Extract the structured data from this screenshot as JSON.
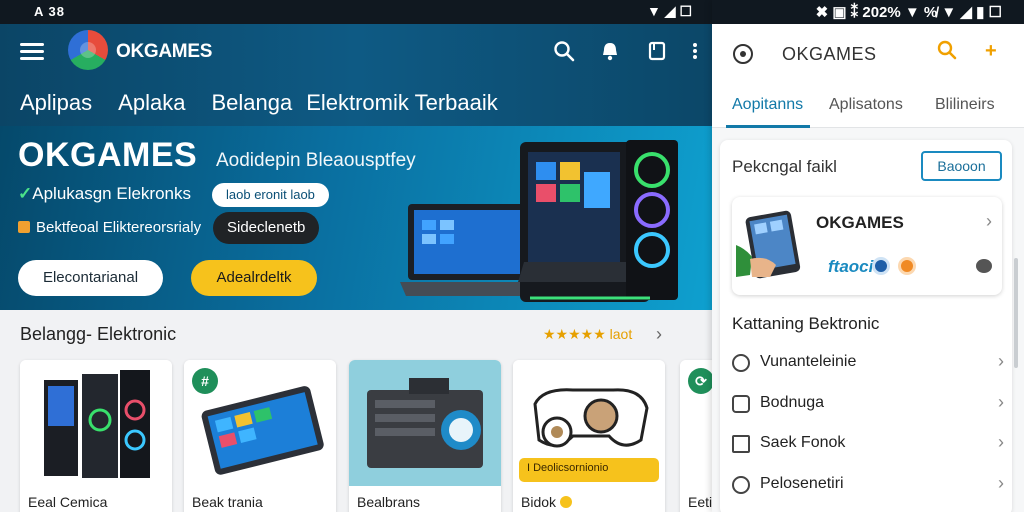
{
  "left_status": {
    "left": "A 38",
    "right": "▼ ◢ ☐"
  },
  "appbar": {
    "brand": "OKGAMES",
    "nav": [
      "Aplipas",
      "Aplaka",
      "Belanga",
      "Elektromik Terbaaik"
    ],
    "icons": [
      "search-icon",
      "notifications-icon",
      "bookmark-icon",
      "more-icon"
    ]
  },
  "hero": {
    "title": "OKGAMES",
    "subtitle": "Aodidepin Bleaousptfey",
    "line1": "Aplukasgn Elekronks",
    "pill_small": "laob eronit laob",
    "line2": "Bektfeoal Eliktereorsrialy",
    "pill_dark": "Sideclenetb",
    "button_white": "Elecontarianal",
    "button_yellow": "Adealrdeltk"
  },
  "shelf": {
    "heading": "Belangg- Elektronic",
    "rating": "★★★★★ laot",
    "products": [
      {
        "caption": "Eeal Cemica"
      },
      {
        "caption": "Beak trania"
      },
      {
        "caption": "Bealbrans"
      },
      {
        "caption": "Bidok",
        "tag": "I Deolicsornionio"
      },
      {
        "caption": "Eeti"
      }
    ]
  },
  "right_status": {
    "text": "✖ ▣ ⁑ 202% ▼ %̸ ▼ ◢ ▮ ☐"
  },
  "panel": {
    "title": "OKGAMES",
    "tabs": [
      "Aopitanns",
      "Aplisatons",
      "Blilineirs"
    ],
    "active_tab": 0,
    "section_title": "Pekcngal  faikl",
    "section_button": "Baooon",
    "game_card": {
      "title": "OKGAMES",
      "meta": "ftaoci"
    },
    "category_heading": "Kattaning Bektronic",
    "categories": [
      {
        "label": "Vunanteleinie",
        "icon": "gamepad-icon"
      },
      {
        "label": "Bodnuga",
        "icon": "image-icon"
      },
      {
        "label": "Saek Fonok",
        "icon": "store-icon"
      },
      {
        "label": "Pelosenetiri",
        "icon": "clock-icon"
      }
    ]
  },
  "colors": {
    "appbar": "#0e5a84",
    "accent": "#1279a8",
    "yellow": "#f6c21c",
    "orange": "#f0a000"
  }
}
